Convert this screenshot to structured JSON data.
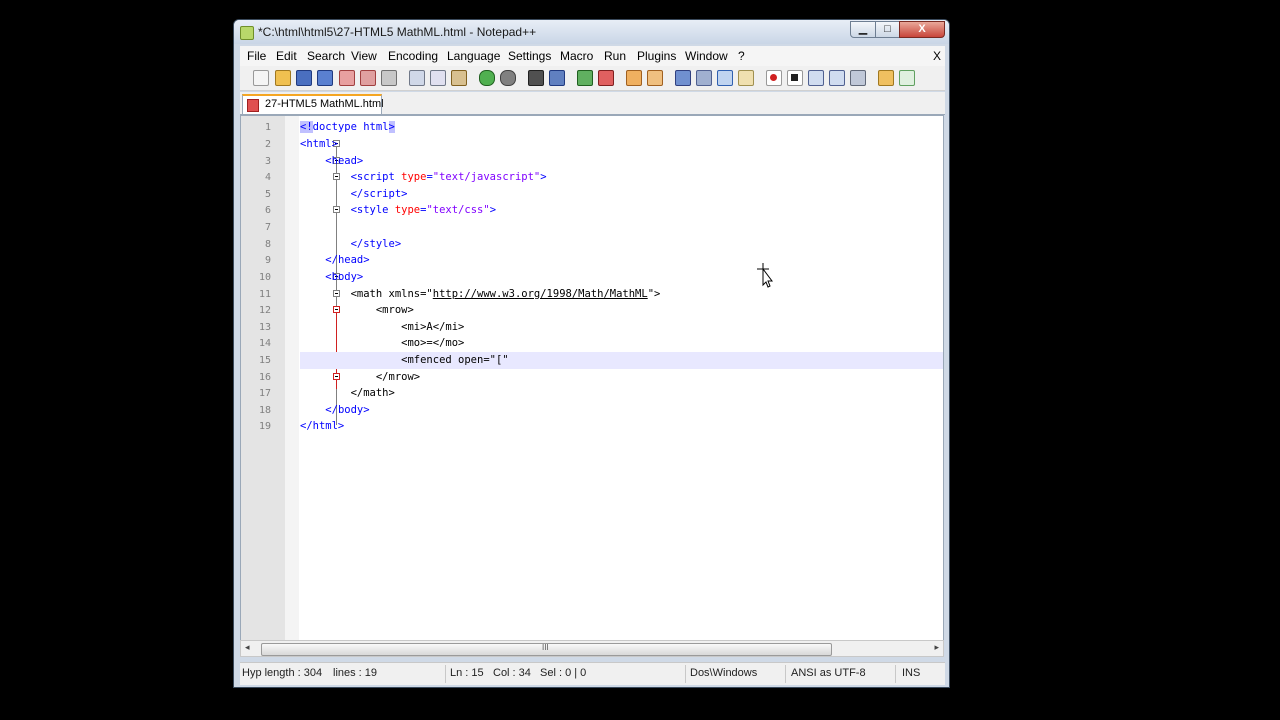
{
  "window": {
    "title": "*C:\\html\\html5\\27-HTML5 MathML.html - Notepad++",
    "minimize": "▁",
    "maximize": "□",
    "close": "X"
  },
  "menu": {
    "items": [
      "File",
      "Edit",
      "Search",
      "View",
      "Encoding",
      "Language",
      "Settings",
      "Macro",
      "Run",
      "Plugins",
      "Window",
      "?"
    ],
    "close": "X"
  },
  "tab": {
    "label": "27-HTML5 MathML.html"
  },
  "editor": {
    "line_numbers": [
      "1",
      "2",
      "3",
      "4",
      "5",
      "6",
      "7",
      "8",
      "9",
      "10",
      "11",
      "12",
      "13",
      "14",
      "15",
      "16",
      "17",
      "18",
      "19"
    ],
    "current_line": 15
  },
  "scrollbar": {
    "left": "◂",
    "right": "▸",
    "grip": "III"
  },
  "status": {
    "length": "Hyp length : 304",
    "lines": "lines : 19",
    "ln": "Ln : 15",
    "col": "Col : 34",
    "sel": "Sel : 0 | 0",
    "eol": "Dos\\Windows",
    "encoding": "ANSI as UTF-8",
    "mode": "INS"
  }
}
